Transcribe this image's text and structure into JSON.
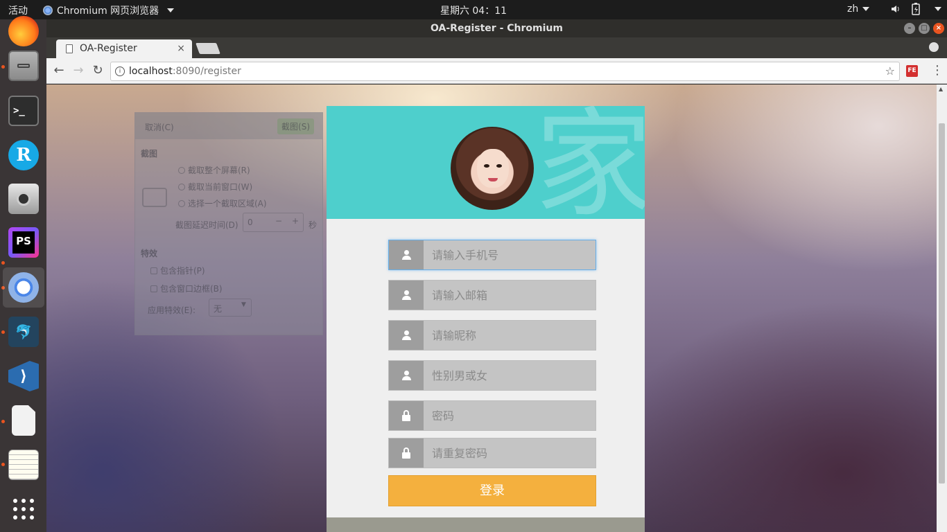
{
  "topbar": {
    "activities": "活动",
    "app_name": "Chromium 网页浏览器",
    "clock": "星期六 04：11",
    "lang": "zh"
  },
  "window": {
    "title": "OA-Register - Chromium"
  },
  "tab": {
    "title": "OA-Register",
    "close": "×"
  },
  "toolbar": {
    "url_host": "localhost",
    "url_path": ":8090/register",
    "ext_label": "FE"
  },
  "ghost_dialog": {
    "cancel": "取消(C)",
    "capture": "截图(S)",
    "section_capture": "截图",
    "opt_screen": "截取整个屏幕(R)",
    "opt_window": "截取当前窗口(W)",
    "opt_area": "选择一个截取区域(A)",
    "delay_label": "截图延迟时间(D)",
    "delay_value": "0",
    "delay_unit": "秒",
    "section_effects": "特效",
    "opt_pointer": "包含指针(P)",
    "opt_border": "包含窗口边框(B)",
    "effect_label": "应用特效(E):",
    "effect_value": "无"
  },
  "form": {
    "header_deco": "家",
    "fields": [
      {
        "placeholder": "请输入手机号",
        "icon": "user-icon"
      },
      {
        "placeholder": "请输入邮箱",
        "icon": "user-icon"
      },
      {
        "placeholder": "请输昵称",
        "icon": "user-icon"
      },
      {
        "placeholder": "性别男或女",
        "icon": "user-icon"
      },
      {
        "placeholder": "密码",
        "icon": "lock-icon"
      },
      {
        "placeholder": "请重复密码",
        "icon": "lock-icon"
      }
    ],
    "submit_label": "登录"
  },
  "colors": {
    "header_teal": "#4ecfcc",
    "button_orange": "#f4b03e",
    "ubuntu_orange": "#e95420"
  }
}
